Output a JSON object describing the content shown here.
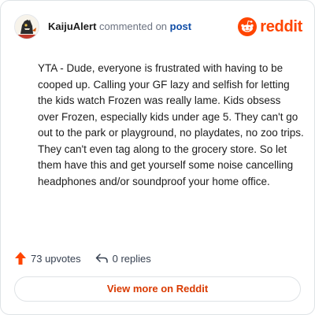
{
  "header": {
    "author": "KaijuAlert",
    "action_text": "commented on",
    "post_link": "post",
    "brand_name": "reddit",
    "avatar_icon": "kaiju-avatar-icon",
    "brand_icon": "reddit-snoo-icon"
  },
  "comment": {
    "text": "YTA - Dude, everyone is frustrated with having to be cooped up. Calling your GF lazy and selfish for letting the kids watch Frozen was really lame. Kids obsess over Frozen, especially kids under age 5. They can't go out to the park or playground, no playdates, no zoo trips. They can't even tag along to the grocery store. So let them have this and get yourself some noise cancelling headphones and/or soundproof your home office."
  },
  "stats": {
    "upvotes": "73 upvotes",
    "replies": "0 replies",
    "upvote_icon": "upvote-arrow-icon",
    "reply_icon": "reply-arrow-icon"
  },
  "footer": {
    "button_label": "View more on Reddit"
  },
  "colors": {
    "brand": "#ff4500",
    "upvote": "#ff4500",
    "link": "#0f4da6",
    "button_text": "#d93a00",
    "border": "#dfe3e6"
  }
}
